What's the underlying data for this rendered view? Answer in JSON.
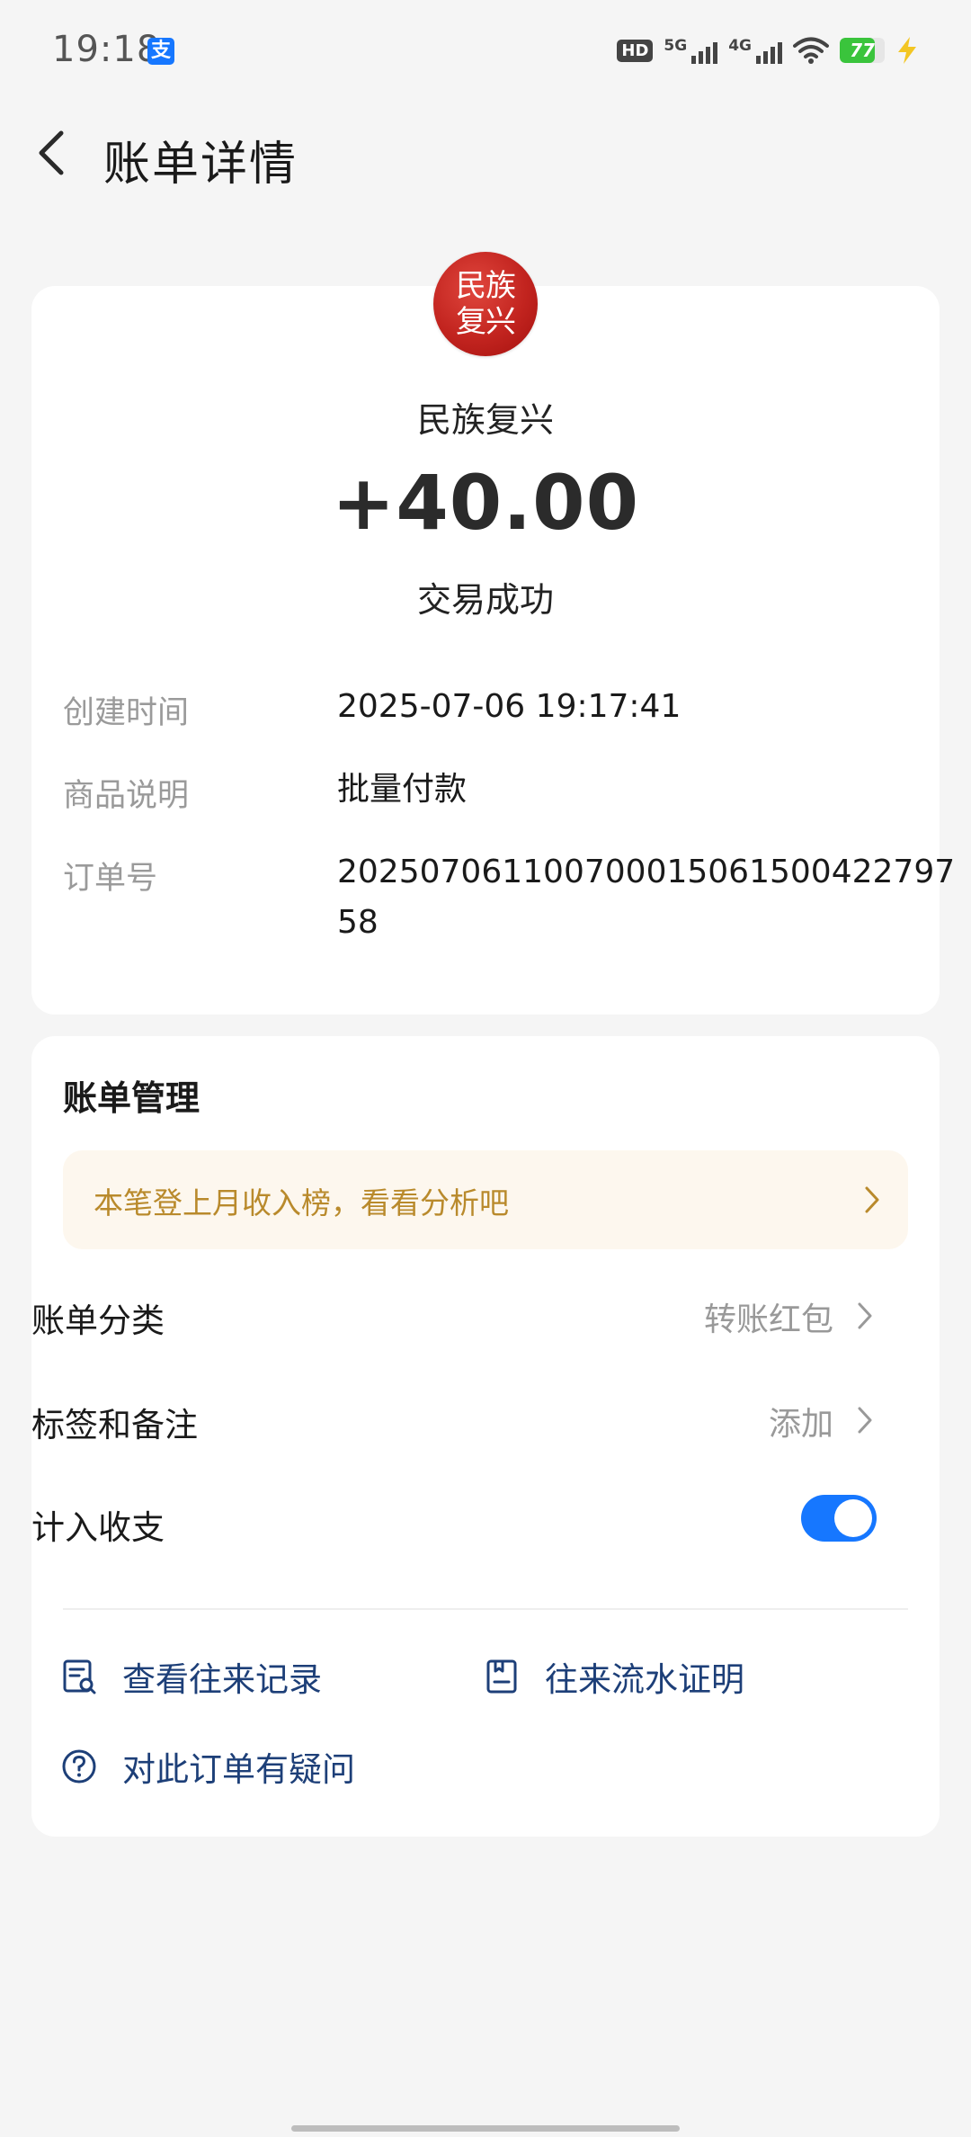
{
  "status_bar": {
    "time": "19:18",
    "app_icon": "支",
    "hd_label": "HD",
    "net1": "5G",
    "net2": "4G",
    "battery": "77"
  },
  "header": {
    "title": "账单详情"
  },
  "summary": {
    "avatar_text": "民族复兴",
    "payee": "民族复兴",
    "amount": "+40.00",
    "status": "交易成功"
  },
  "details": [
    {
      "label": "创建时间",
      "value": "2025-07-06 19:17:41"
    },
    {
      "label": "商品说明",
      "value": "批量付款"
    },
    {
      "label": "订单号",
      "value": "20250706110070001506150042279758"
    }
  ],
  "management": {
    "title": "账单管理",
    "banner": "本笔登上月收入榜，看看分析吧",
    "category_label": "账单分类",
    "category_value": "转账红包",
    "tags_label": "标签和备注",
    "tags_value": "添加",
    "count_label": "计入收支",
    "count_enabled": true
  },
  "actions": {
    "history": "查看往来记录",
    "proof": "往来流水证明",
    "question": "对此订单有疑问"
  },
  "colors": {
    "accent": "#1677ff",
    "link": "#1d3f78",
    "banner_text": "#b98a2c",
    "banner_bg": "#fdf7ee"
  }
}
